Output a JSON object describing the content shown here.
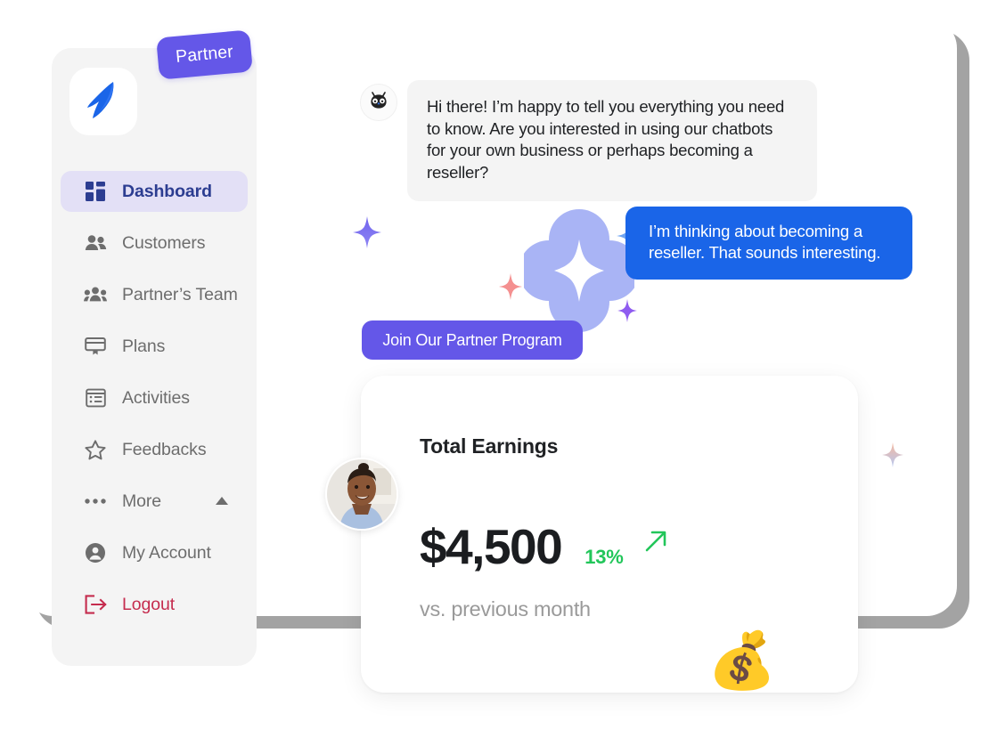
{
  "app": {
    "logo_icon": "penguin-logo-icon",
    "badge_label": "Partner"
  },
  "sidebar": {
    "items": [
      {
        "label": "Dashboard",
        "icon": "grid-dashboard-icon",
        "active": true
      },
      {
        "label": "Customers",
        "icon": "two-people-icon",
        "active": false
      },
      {
        "label": "Partner’s Team",
        "icon": "group-people-icon",
        "active": false
      },
      {
        "label": "Plans",
        "icon": "monitor-plans-icon",
        "active": false
      },
      {
        "label": "Activities",
        "icon": "list-activities-icon",
        "active": false
      },
      {
        "label": "Feedbacks",
        "icon": "star-outline-icon",
        "active": false
      },
      {
        "label": "More",
        "icon": "ellipsis-icon",
        "active": false,
        "caret": "chevron-up-icon"
      },
      {
        "label": "My Account",
        "icon": "user-circle-icon",
        "active": false
      },
      {
        "label": "Logout",
        "icon": "logout-arrow-icon",
        "active": false,
        "danger": true
      }
    ]
  },
  "chat": {
    "bot_avatar_icon": "bot-face-icon",
    "bot_message": "Hi there! I’m happy to tell you everything you need to know.  Are you interested in using our chatbots for your own business or perhaps becoming a reseller?",
    "user_message": "I’m thinking about becoming a reseller. That sounds interesting.",
    "cta_label": "Join Our Partner Program"
  },
  "earnings": {
    "title": "Total Earnings",
    "amount": "$4,500",
    "delta": "13%",
    "delta_arrow_icon": "arrow-up-right-icon",
    "subtitle": "vs. previous month",
    "money_bag_icon": "💰",
    "avatar_icon": "user-photo-avatar"
  },
  "colors": {
    "brand_purple": "#6457e8",
    "user_bubble_blue": "#1a65e8",
    "active_nav_bg": "#e3e0f6",
    "active_nav_text": "#2c3d91",
    "logout_red": "#c52c4e",
    "delta_green": "#22c65a",
    "sidebar_bg": "#f4f4f4",
    "bot_bubble_bg": "#f4f4f4"
  }
}
